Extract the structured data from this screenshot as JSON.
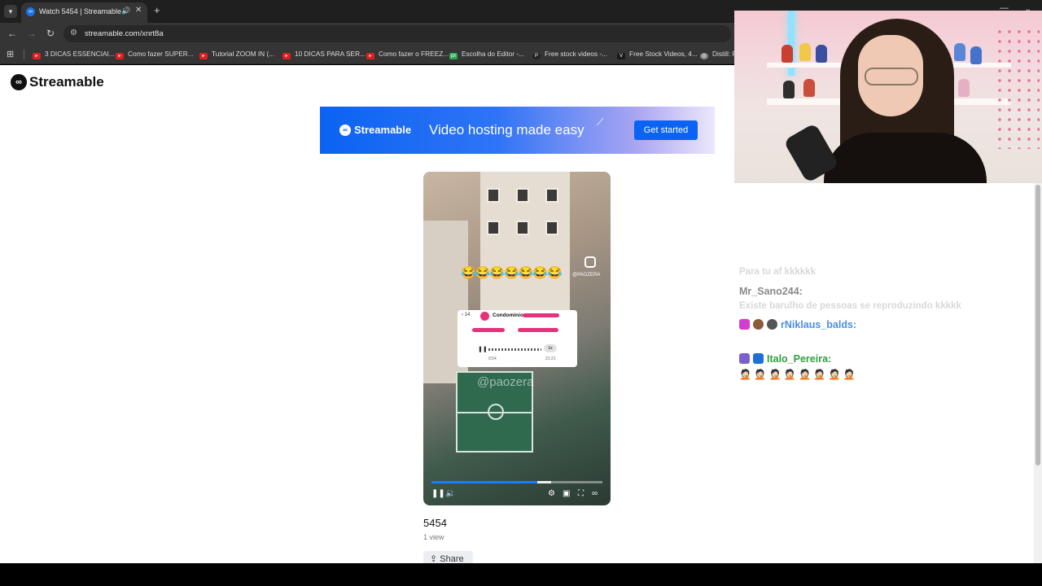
{
  "browser": {
    "tab_title": "Watch 5454 | Streamable",
    "url": "streamable.com/xnrt8a",
    "bookmarks": [
      {
        "label": "3 DICAS ESSENCIAI...",
        "color": "#e02020"
      },
      {
        "label": "Como fazer SUPER...",
        "color": "#e02020"
      },
      {
        "label": "Tutorial ZOOM IN (...",
        "color": "#e02020"
      },
      {
        "label": "10 DICAS PARA SER...",
        "color": "#e02020"
      },
      {
        "label": "Como fazer o FREEZ...",
        "color": "#e02020"
      },
      {
        "label": "Escolha do Editor -...",
        "color": "#2aa852"
      },
      {
        "label": "Free stock videos -...",
        "color": "#222222"
      },
      {
        "label": "Free Stock Videos, 4...",
        "color": "#1a1a1a"
      },
      {
        "label": "Distill: F",
        "color": "#888888"
      }
    ]
  },
  "site": {
    "logo_text": "Streamable",
    "banner": {
      "brand": "Streamable",
      "tagline": "Video hosting made easy",
      "cta": "Get started"
    },
    "video": {
      "overlay_emojis": "😂😂😂😂😂😂😂",
      "ig_handle": "@PAOZERA",
      "chat_title": "Condominio",
      "chat_back_count": "14",
      "audio_time_left": "0:54",
      "audio_time_right": "21:21",
      "speed": "1x",
      "watermark": "@paozera",
      "progress": 0.62,
      "buffered": 0.08
    },
    "title": "5454",
    "views": "1 view",
    "share_label": "Share"
  },
  "chat": {
    "faded_top": "Para tu af kkkkkk",
    "messages": [
      {
        "user": "Mr_Sano244:",
        "color": "#8a8a8a",
        "text": "Existe barulho de pessoas se reproduzindo kkkkk",
        "faded": true
      },
      {
        "user": "rNiklaus_balds:",
        "color": "#4a8fe0",
        "text": "",
        "badges": [
          "#d23cd0",
          "#8a5a3a",
          "#555555"
        ]
      },
      {
        "user": "Italo_Pereira:",
        "color": "#2f9e3f",
        "text": "🤦🏻 🤦🏻 🤦🏻 🤦🏻 🤦🏻 🤦🏻 🤦🏻 🤦🏻",
        "badges": [
          "#7a5fd0",
          "#1e6fd8"
        ]
      }
    ]
  }
}
